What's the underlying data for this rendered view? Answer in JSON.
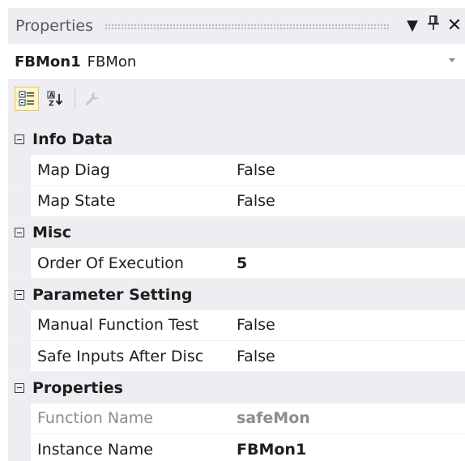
{
  "panel": {
    "title": "Properties",
    "pin_icon": "pin-icon",
    "menu_icon": "dropdown-arrow-icon",
    "close_icon": "close-icon"
  },
  "selector": {
    "object_name": "FBMon1",
    "object_type": "FBMon"
  },
  "toolbar": {
    "buttons": [
      {
        "name": "categorized-view-button",
        "icon": "categorized-icon",
        "active": true
      },
      {
        "name": "alphabetical-view-button",
        "icon": "sort-az-icon",
        "active": false
      },
      {
        "name": "property-pages-button",
        "icon": "wrench-icon",
        "active": false,
        "disabled": true
      }
    ]
  },
  "grid": {
    "categories": [
      {
        "label": "Info Data",
        "properties": [
          {
            "name": "Map Diag",
            "value": "False"
          },
          {
            "name": "Map State",
            "value": "False"
          }
        ]
      },
      {
        "label": "Misc",
        "properties": [
          {
            "name": "Order Of Execution",
            "value": "5"
          }
        ]
      },
      {
        "label": "Parameter Setting",
        "properties": [
          {
            "name": "Manual Function Test",
            "value": "False"
          },
          {
            "name": "Safe Inputs After Disc",
            "value": "False"
          }
        ]
      },
      {
        "label": "Properties",
        "properties": [
          {
            "name": "Function Name",
            "value": "safeMon"
          },
          {
            "name": "Instance Name",
            "value": "FBMon1"
          }
        ]
      }
    ]
  },
  "colors": {
    "panel_bg": "#eeeef2",
    "grid_row_bg": "#ffffff",
    "active_tool_bg": "#fff6c8",
    "disabled_text": "#8d8d8d"
  }
}
